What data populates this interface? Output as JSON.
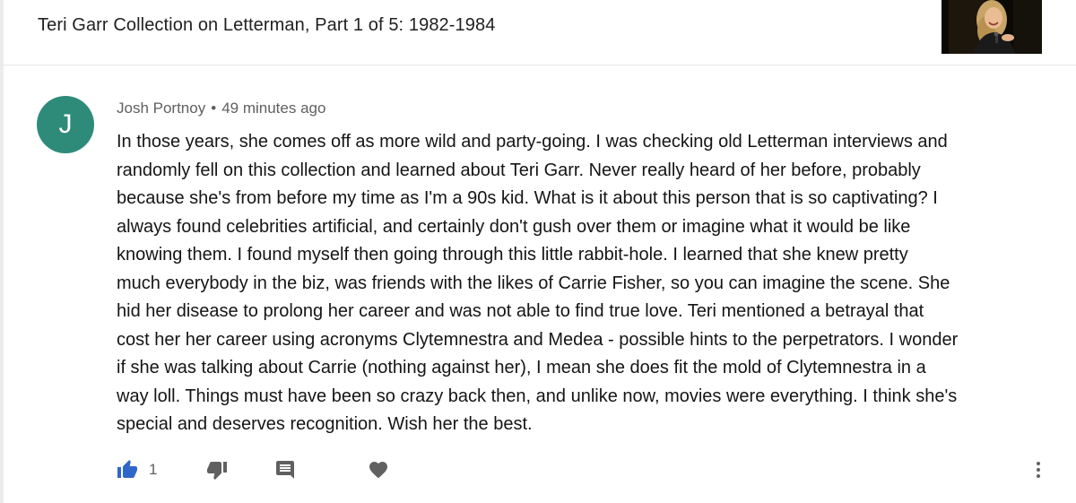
{
  "header": {
    "video_title": "Teri Garr Collection on Letterman, Part 1 of 5: 1982-1984",
    "thumbnail": "video-thumbnail"
  },
  "comment": {
    "avatar_letter": "J",
    "avatar_color": "#2e8b7a",
    "author": "Josh Portnoy",
    "separator": "•",
    "timestamp": "49 minutes ago",
    "lines": [
      "In those years, she comes off as more wild and party-going. I was checking old Letterman interviews and",
      "randomly fell on this collection and learned about Teri Garr. Never really heard of her before, probably",
      "because she's from before my time as I'm a 90s kid. What is it about this person that is so captivating? I",
      "always found celebrities artificial, and certainly don't gush over them or imagine what it would be like",
      "knowing them. I found myself then going through this little rabbit-hole. I learned that she knew pretty",
      "much everybody in the biz, was friends with the likes of Carrie Fisher, so you can imagine the scene. She",
      "hid her disease to prolong her career and was not able to find true love. Teri mentioned a betrayal that",
      "cost her her career using acronyms Clytemnestra and Medea - possible hints to the perpetrators. I wonder",
      "if she was talking about Carrie (nothing against her), I mean she does fit the mold of Clytemnestra in a",
      "way loll. Things must have been so crazy back then, and unlike now, movies were everything. I think she's",
      "special and deserves recognition. Wish her the best."
    ]
  },
  "actions": {
    "like_count": "1",
    "like_icon": "thumbs-up-icon",
    "like_color": "#2f66c9",
    "dislike_icon": "thumbs-down-icon",
    "reply_icon": "comment-icon",
    "heart_icon": "heart-icon",
    "more_icon": "more-vert-icon",
    "icon_color": "#606060"
  }
}
